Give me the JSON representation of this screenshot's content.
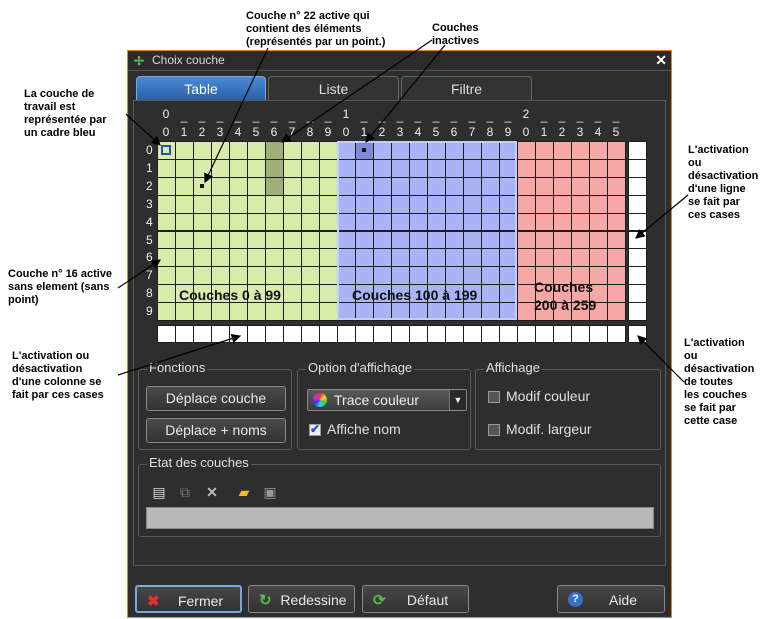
{
  "annotations": {
    "layer22": [
      "Couche n° 22 active qui",
      "contient des éléments",
      "(représentés par un point.)"
    ],
    "inactive": [
      "Couches",
      "inactives"
    ],
    "work_layer": [
      "La couche de",
      "travail est",
      "représentée par",
      "un cadre bleu"
    ],
    "row_toggle": [
      "L'activation",
      "ou",
      "désactivation",
      "d'une ligne",
      "se fait par",
      "ces cases"
    ],
    "layer16": [
      "Couche n° 16 active",
      "sans element (sans",
      "point)"
    ],
    "col_toggle": [
      "L'activation ou",
      "désactivation",
      "d'une colonne se",
      "fait par ces cases"
    ],
    "all_toggle": [
      "L'activation",
      "ou",
      "désactivation",
      "de toutes",
      "les couches",
      "se fait par",
      "cette case"
    ]
  },
  "window": {
    "title": "Choix couche",
    "close_glyph": "✕"
  },
  "tabs": [
    {
      "label": "Table",
      "active": true
    },
    {
      "label": "Liste",
      "active": false
    },
    {
      "label": "Filtre",
      "active": false
    }
  ],
  "grid": {
    "column_tens": [
      {
        "col": 0,
        "label": "0"
      },
      {
        "col": 10,
        "label": "1"
      },
      {
        "col": 20,
        "label": "2"
      }
    ],
    "column_units": [
      "0",
      "1",
      "2",
      "3",
      "4",
      "5",
      "6",
      "7",
      "8",
      "9",
      "0",
      "1",
      "2",
      "3",
      "4",
      "5",
      "6",
      "7",
      "8",
      "9",
      "0",
      "1",
      "2",
      "3",
      "4",
      "5"
    ],
    "row_labels": [
      "0",
      "1",
      "2",
      "3",
      "4",
      "5",
      "6",
      "7",
      "8",
      "9"
    ],
    "group_labels": [
      [
        "Couches 0 à 99"
      ],
      [
        "Couches 100 à 199"
      ],
      [
        "Couches",
        "200 à 259"
      ]
    ],
    "colors": {
      "green": "#d7ecaa",
      "blue": "#aab3f5",
      "red": "#f7a7a6",
      "inactive_green": "#9eaf78",
      "inactive_blue": "#7f89d8"
    }
  },
  "fonctions": {
    "legend": "Fonctions",
    "move_layer": "Déplace couche",
    "move_names": "Déplace + noms"
  },
  "options": {
    "legend": "Option d'affichage",
    "combo_value": "Trace couleur",
    "show_name": "Affiche nom",
    "show_name_checked": true
  },
  "affichage": {
    "legend": "Affichage",
    "modif_color": "Modif couleur",
    "modif_width": "Modif. largeur"
  },
  "etat": {
    "legend": "Etat des couches",
    "tools": [
      "printer-icon",
      "layers-icon",
      "delete-icon",
      "folder-open-icon",
      "save-icon"
    ]
  },
  "buttons": {
    "close": "Fermer",
    "redraw": "Redessine",
    "default": "Défaut",
    "help": "Aide"
  }
}
